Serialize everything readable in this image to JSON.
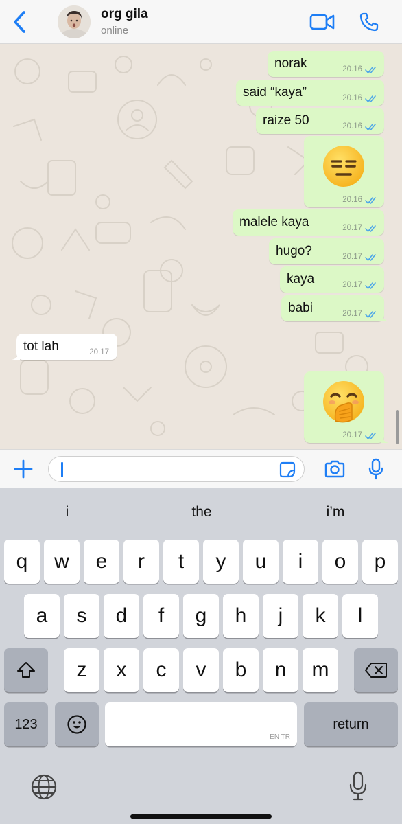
{
  "header": {
    "contact_name": "org gila",
    "status": "online"
  },
  "messages": [
    {
      "direction": "out",
      "text": "norak",
      "time": "20.16"
    },
    {
      "direction": "out",
      "text": "said “kaya”",
      "time": "20.16"
    },
    {
      "direction": "out",
      "text": "raize 50",
      "time": "20.16"
    },
    {
      "direction": "out",
      "emoji": "expressionless-face",
      "time": "20.16"
    },
    {
      "direction": "out",
      "text": "malele kaya",
      "time": "20.17"
    },
    {
      "direction": "out",
      "text": "hugo?",
      "time": "20.17"
    },
    {
      "direction": "out",
      "text": "kaya",
      "time": "20.17"
    },
    {
      "direction": "out",
      "text": "babi",
      "time": "20.17"
    },
    {
      "direction": "in",
      "text": "tot lah",
      "time": "20.17"
    },
    {
      "direction": "out",
      "emoji": "face-with-hand-over-mouth",
      "time": "20.17"
    }
  ],
  "input": {
    "value": "",
    "icons": [
      "plus-icon",
      "sticker-icon",
      "camera-icon",
      "microphone-icon"
    ]
  },
  "keyboard": {
    "suggestions": [
      "i",
      "the",
      "i’m"
    ],
    "row1": [
      "q",
      "w",
      "e",
      "r",
      "t",
      "y",
      "u",
      "i",
      "o",
      "p"
    ],
    "row2": [
      "a",
      "s",
      "d",
      "f",
      "g",
      "h",
      "j",
      "k",
      "l"
    ],
    "row3": [
      "z",
      "x",
      "c",
      "v",
      "b",
      "n",
      "m"
    ],
    "numbers_label": "123",
    "return_label": "return",
    "space_hint": "EN TR"
  },
  "colors": {
    "accent": "#1e7ef5",
    "outgoing_bubble": "#dcf8c6",
    "incoming_bubble": "#ffffff",
    "chat_background": "#ece5dd",
    "read_ticks": "#4fa7e8"
  }
}
